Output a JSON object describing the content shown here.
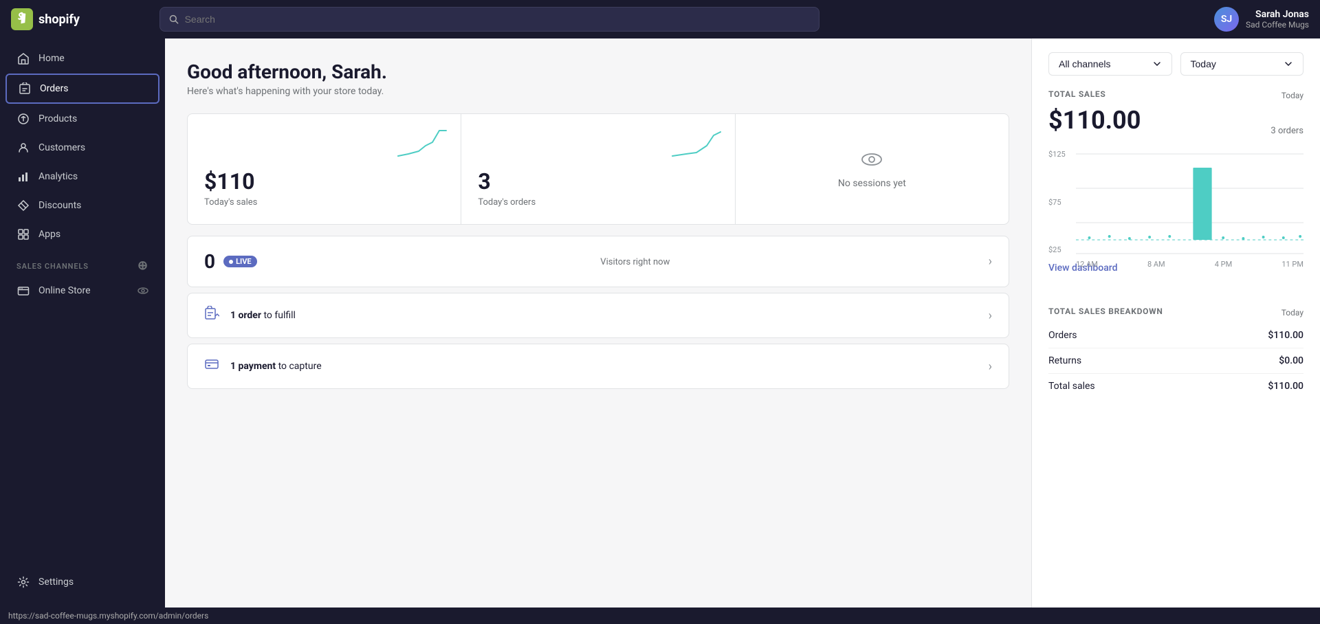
{
  "topnav": {
    "logo_text": "shopify",
    "search_placeholder": "Search"
  },
  "user": {
    "name": "Sarah Jonas",
    "store": "Sad Coffee Mugs",
    "initials": "SJ"
  },
  "sidebar": {
    "nav_items": [
      {
        "id": "home",
        "label": "Home",
        "icon": "home"
      },
      {
        "id": "orders",
        "label": "Orders",
        "icon": "orders",
        "highlighted": true
      },
      {
        "id": "products",
        "label": "Products",
        "icon": "products"
      },
      {
        "id": "customers",
        "label": "Customers",
        "icon": "customers"
      },
      {
        "id": "analytics",
        "label": "Analytics",
        "icon": "analytics"
      },
      {
        "id": "discounts",
        "label": "Discounts",
        "icon": "discounts"
      },
      {
        "id": "apps",
        "label": "Apps",
        "icon": "apps"
      }
    ],
    "sales_channels_label": "SALES CHANNELS",
    "online_store_label": "Online Store",
    "settings_label": "Settings"
  },
  "main": {
    "greeting": "Good afternoon, Sarah.",
    "subtext": "Here's what's happening with your store today.",
    "stats": [
      {
        "id": "sales",
        "value": "$110",
        "label": "Today's sales",
        "has_chart": true
      },
      {
        "id": "orders",
        "value": "3",
        "label": "Today's orders",
        "has_chart": true
      },
      {
        "id": "sessions",
        "value": "",
        "label": "",
        "no_sessions": true,
        "no_sessions_text": "No sessions yet"
      }
    ],
    "live_section": {
      "count": "0",
      "badge": "LIVE",
      "label": "Visitors right now"
    },
    "order_card": {
      "bold": "1 order",
      "rest": " to fulfill"
    },
    "payment_card": {
      "bold": "1 payment",
      "rest": " to capture"
    }
  },
  "right_panel": {
    "channels_dropdown": "All channels",
    "time_dropdown": "Today",
    "total_sales_title": "TOTAL SALES",
    "total_sales_today": "Today",
    "total_amount": "$110.00",
    "orders_count": "3 orders",
    "chart": {
      "y_labels": [
        "$125",
        "$75",
        "$25"
      ],
      "x_labels": [
        "12 AM",
        "8 AM",
        "4 PM",
        "11 PM"
      ]
    },
    "view_dashboard": "View dashboard",
    "breakdown_title": "TOTAL SALES BREAKDOWN",
    "breakdown_today": "Today",
    "breakdown_rows": [
      {
        "label": "Orders",
        "value": "$110.00"
      },
      {
        "label": "Returns",
        "value": "$0.00"
      },
      {
        "label": "Total sales",
        "value": "$110.00"
      }
    ]
  },
  "status_bar": {
    "url": "https://sad-coffee-mugs.myshopify.com/admin/orders"
  }
}
